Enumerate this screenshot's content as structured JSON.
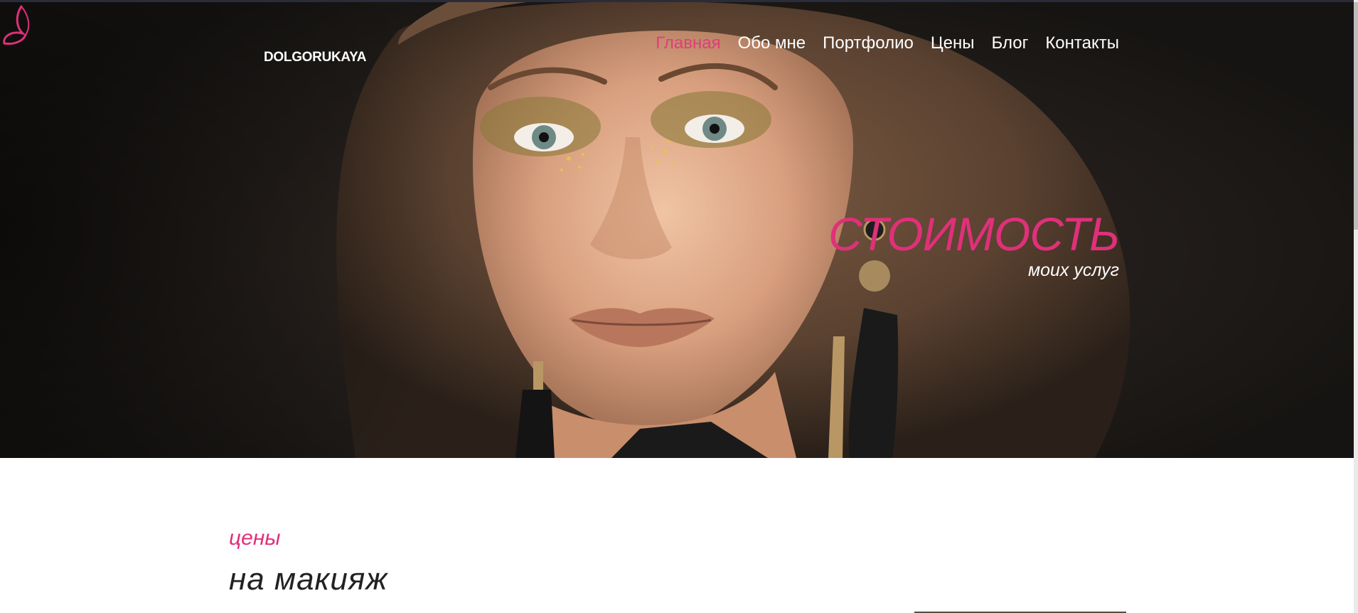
{
  "brand": {
    "logo_text": "DOLGORUKAYA",
    "accent_color": "#e0307a"
  },
  "nav": {
    "items": [
      {
        "label": "Главная",
        "active": true
      },
      {
        "label": "Обо мне",
        "active": false
      },
      {
        "label": "Портфолио",
        "active": false
      },
      {
        "label": "Цены",
        "active": false
      },
      {
        "label": "Блог",
        "active": false
      },
      {
        "label": "Контакты",
        "active": false
      }
    ]
  },
  "hero": {
    "title": "СТОИМОСТЬ",
    "subtitle": "моих услуг"
  },
  "section": {
    "label": "цены",
    "title": "на макияж"
  }
}
